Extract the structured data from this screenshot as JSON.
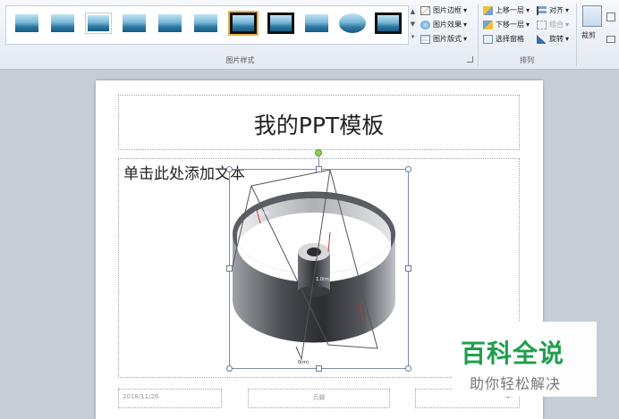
{
  "ribbon": {
    "picture_styles_label": "图片样式",
    "arrange_label": "排列",
    "picture_border": "图片边框",
    "picture_effects": "图片效果",
    "picture_layout": "图片版式",
    "bring_forward": "上移一层",
    "send_backward": "下移一层",
    "selection_pane": "选择窗格",
    "align": "对齐",
    "group": "组合",
    "rotate": "旋转",
    "crop": "裁剪"
  },
  "slide": {
    "title": "我的PPT模板",
    "body_placeholder": "单击此处添加文本",
    "footer_date": "2018/11/26",
    "footer_text": "页脚",
    "footer_page": "‹#›"
  },
  "picture": {
    "label_left": "0.5(m)",
    "label_center": "1.0(m)",
    "label_bottom": "0(m)"
  },
  "watermark": {
    "line1": "百科全说",
    "line2": "助你轻松解决"
  },
  "colors": {
    "accent_green": "#1f9e4c",
    "ribbon_bg": "#e4eaf2",
    "canvas_bg": "#c5cdd6"
  }
}
